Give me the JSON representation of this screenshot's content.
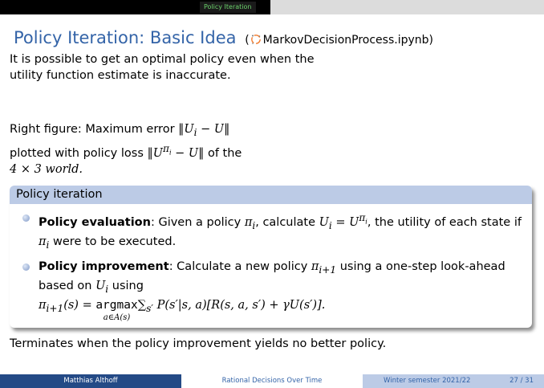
{
  "header": {
    "section": "Policy Iteration"
  },
  "slide": {
    "title": "Policy Iteration: Basic Idea",
    "reference_open": "(",
    "reference_file": "MarkovDecisionProcess.ipynb)",
    "para1": "It is possible to get an optimal policy even when the utility function estimate is inaccurate.",
    "para2_prefix": "Right figure: Maximum error",
    "para2_err": "‖U",
    "para2_err_sub": "i",
    "para2_err_end": " − U‖",
    "para2_mid": "plotted with policy loss",
    "para2_loss": "‖U",
    "para2_loss_sup": "π",
    "para2_loss_supsub": "i",
    "para2_loss_end": " − U‖",
    "para2_tail1": "of the",
    "para2_tail2": "4 × 3 world.",
    "block": {
      "title": "Policy iteration",
      "item1_bold": "Policy evaluation",
      "item1_a": ": Given a policy ",
      "item1_pi": "π",
      "item1_i": "i",
      "item1_b": ", calculate ",
      "item1_U": "U",
      "item1_eq": " = U",
      "item1_sup": "π",
      "item1_c": ", the utility of each state if ",
      "item1_d": " were to be executed.",
      "item2_bold": "Policy improvement",
      "item2_a": ": Calculate a new policy ",
      "item2_sub": "i+1",
      "item2_b": " using a one-step look-ahead based on ",
      "item2_c": " using",
      "formula_left": "π",
      "formula_s": "(s) = ",
      "formula_argmax": "argmax",
      "formula_under": "a∈A(s)",
      "formula_sum": "∑",
      "formula_sum_sub": "s′",
      "formula_right": " P(s′|s, a)[R(s, a, s′) + γU(s′)]."
    },
    "para3": "Terminates when the policy improvement yields no better policy."
  },
  "footer": {
    "author": "Matthias Althoff",
    "course": "Rational Decisions Over Time",
    "semester": "Winter semester 2021/22",
    "page": "27 / 31"
  }
}
